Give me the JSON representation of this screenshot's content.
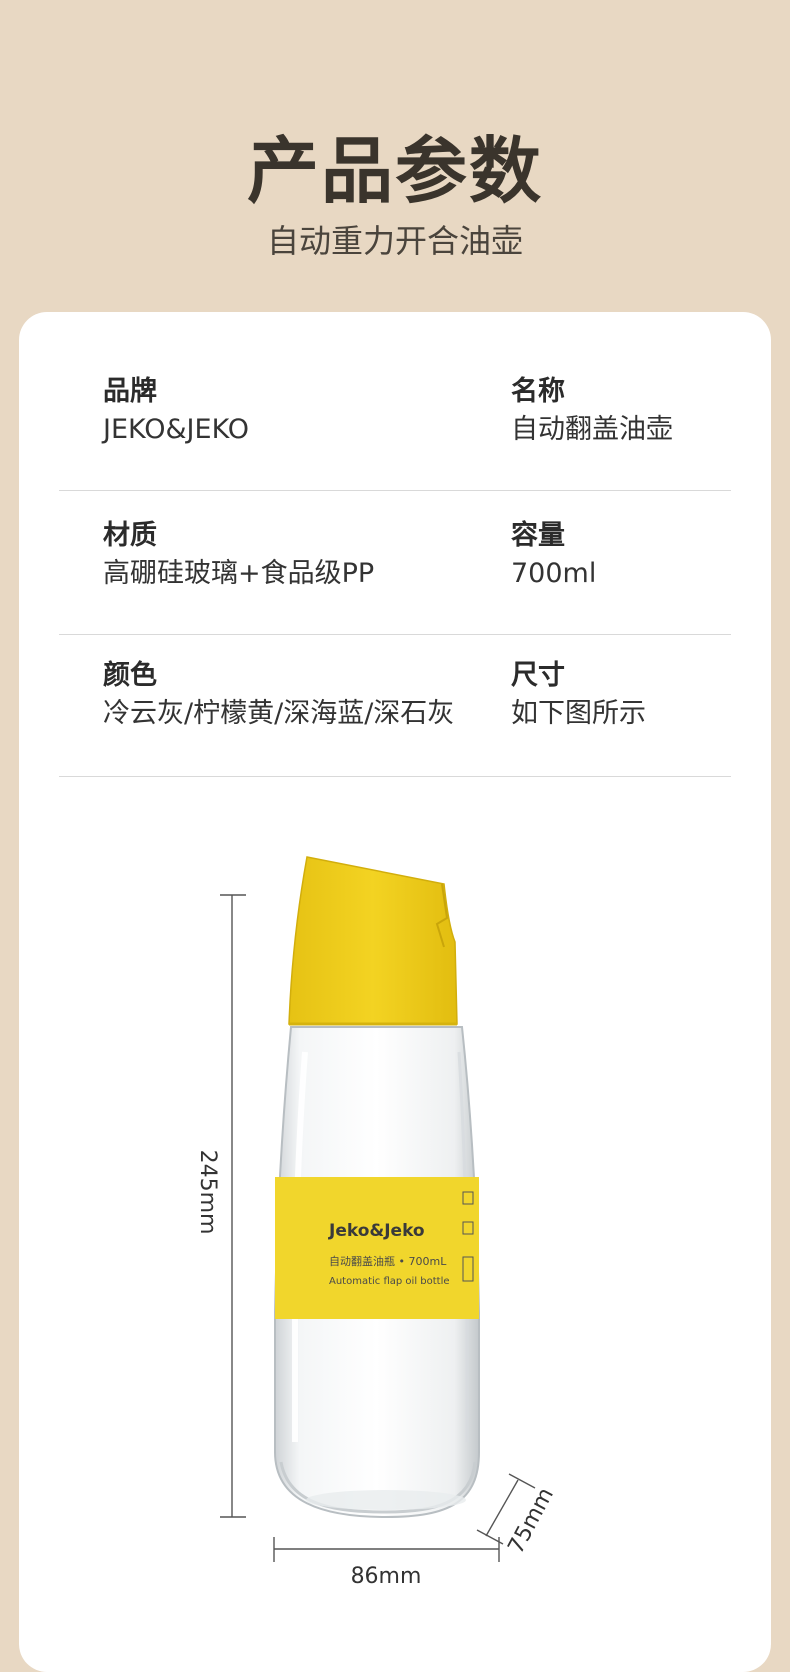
{
  "header": {
    "title": "产品参数",
    "subtitle": "自动重力开合油壶"
  },
  "specs": [
    {
      "left_key": "品牌",
      "left_value": "JEKO&JEKO",
      "right_key": "名称",
      "right_value": "自动翻盖油壶"
    },
    {
      "left_key": "材质",
      "left_value": "高硼硅玻璃+食品级PP",
      "right_key": "容量",
      "right_value": "700ml"
    },
    {
      "left_key": "颜色",
      "left_value": "冷云灰/柠檬黄/深海蓝/深石灰",
      "right_key": "尺寸",
      "right_value": "如下图所示"
    }
  ],
  "product": {
    "label_brand": "Jeko&Jeko",
    "label_cn": "自动翻盖油瓶 • 700mL",
    "label_en": "Automatic flap oil bottle",
    "dimensions": {
      "height": "245mm",
      "width": "86mm",
      "depth": "75mm"
    },
    "colors": {
      "cap": "#efce1f",
      "label": "#f1d62c",
      "background": "#e8d8c3"
    }
  }
}
